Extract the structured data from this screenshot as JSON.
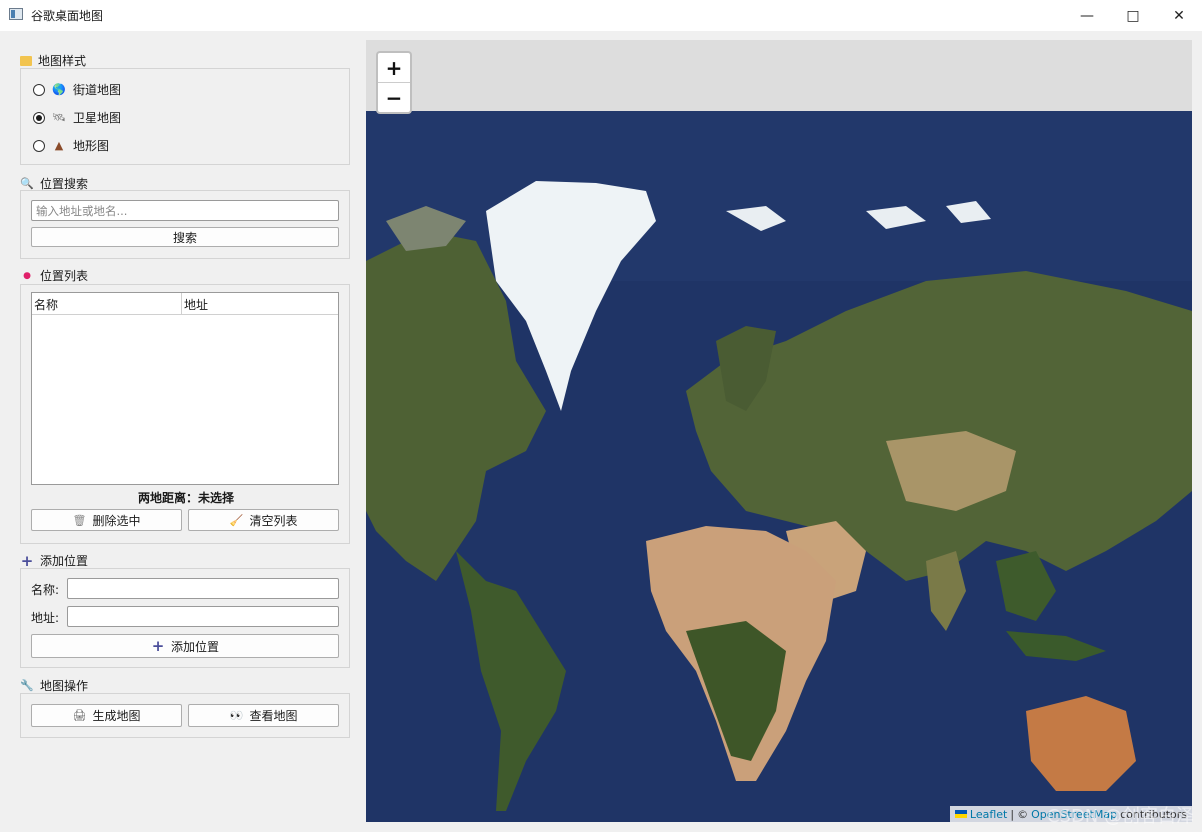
{
  "window": {
    "title": "谷歌桌面地图"
  },
  "sections": {
    "map_style": {
      "title": "地图样式",
      "options": [
        {
          "label": "街道地图",
          "checked": false
        },
        {
          "label": "卫星地图",
          "checked": true
        },
        {
          "label": "地形图",
          "checked": false
        }
      ]
    },
    "search": {
      "title": "位置搜索",
      "placeholder": "输入地址或地名...",
      "button": "搜索"
    },
    "location_list": {
      "title": "位置列表",
      "columns": [
        "名称",
        "地址"
      ],
      "rows": [],
      "distance_label": "两地距离：",
      "distance_value": "未选择",
      "delete_button": "删除选中",
      "clear_button": "清空列表"
    },
    "add_location": {
      "title": "添加位置",
      "name_label": "名称:",
      "address_label": "地址:",
      "name_value": "",
      "address_value": "",
      "button": "添加位置"
    },
    "map_ops": {
      "title": "地图操作",
      "generate_button": "生成地图",
      "view_button": "查看地图"
    }
  },
  "map": {
    "zoom_in": "+",
    "zoom_out": "−",
    "attribution_leaflet": "Leaflet",
    "attribution_sep": "|",
    "attribution_osm": "OpenStreetMap",
    "attribution_suffix": "contributors",
    "watermark": "CSDN @创客白泽"
  },
  "icons": {
    "map_style": "folder-icon",
    "street": "globe-icon",
    "satellite": "satellite-icon",
    "terrain": "mountain-icon",
    "search": "magnifier-icon",
    "list": "pin-icon",
    "add": "plus-icon",
    "ops": "tools-icon",
    "delete": "trash-icon",
    "clear": "broom-icon",
    "generate": "printer-icon",
    "view": "eyes-icon"
  }
}
